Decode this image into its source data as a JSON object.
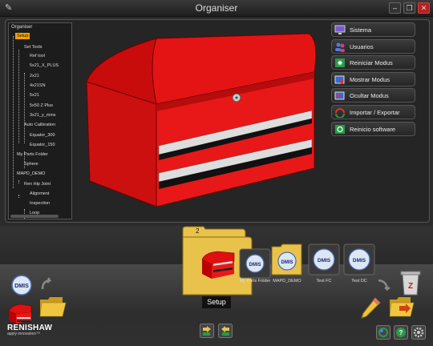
{
  "window": {
    "title": "Organiser",
    "controls": [
      "minimize",
      "restore",
      "close"
    ]
  },
  "tree": {
    "header": "Organiser",
    "nodes": [
      {
        "label": "Setup",
        "selected": true
      },
      {
        "label": "Set Tools"
      },
      {
        "label": "Ref tool"
      },
      {
        "label": "5x21_X_PLUS"
      },
      {
        "label": "2x21"
      },
      {
        "label": "4x21SN"
      },
      {
        "label": "5x21"
      },
      {
        "label": "5x50 Z Plus"
      },
      {
        "label": "3x21_y_mins"
      },
      {
        "label": "Auto Calibration"
      },
      {
        "label": "Equator_300"
      },
      {
        "label": "Equator_150"
      },
      {
        "label": "My Parts Folder"
      },
      {
        "label": "Sphere"
      },
      {
        "label": "MAPD_DEMO"
      },
      {
        "label": "Ren Hip Joint"
      },
      {
        "label": "Alignment"
      },
      {
        "label": "Inspection"
      },
      {
        "label": "Loop"
      }
    ]
  },
  "menu": {
    "items": [
      {
        "label": "Sistema",
        "icon": "system-monitor-icon"
      },
      {
        "label": "Usuarios",
        "icon": "users-icon"
      },
      {
        "label": "Reiniciar Modus",
        "icon": "restart-icon"
      },
      {
        "label": "Mostrar Modus",
        "icon": "show-window-icon"
      },
      {
        "label": "Ocultar Modus",
        "icon": "hide-window-icon"
      },
      {
        "label": "Importar / Exportar",
        "icon": "import-export-icon"
      },
      {
        "label": "Reinicio software",
        "icon": "software-restart-icon"
      }
    ]
  },
  "carousel": {
    "count": "2",
    "selected_label": "Setup",
    "items": [
      {
        "label": "My Parts Folder",
        "icon": "dmis-folder-icon"
      },
      {
        "label": "MAPD_DEMO",
        "icon": "dmis-folder-icon"
      },
      {
        "label": "Test FC",
        "icon": "dmis-program-icon"
      },
      {
        "label": "Test DC",
        "icon": "dmis-program-icon"
      }
    ]
  },
  "brand": {
    "name": "RENISHAW",
    "tagline": "apply innovation™"
  },
  "colors": {
    "accent": "#f5a300",
    "chest_red": "#e01010",
    "folder_gold": "#e8c24a"
  }
}
